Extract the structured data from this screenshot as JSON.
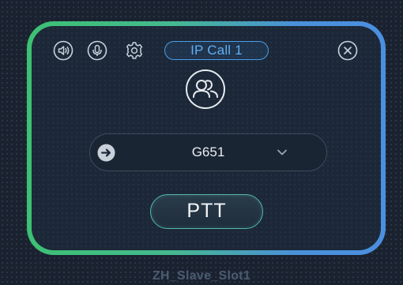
{
  "colors": {
    "frame_left": "#3cc173",
    "frame_right": "#4b8fe0",
    "pill_accent": "#5fb0f5",
    "ptt_border": "#53b8a8",
    "card_bg": "#1c2838"
  },
  "toolbar": {
    "speaker_icon": "speaker-icon",
    "mic_icon": "microphone-icon",
    "settings_icon": "gear-icon",
    "close_icon": "close-icon"
  },
  "call": {
    "title": "IP Call 1",
    "avatar_icon": "group-users-icon"
  },
  "selector": {
    "icon": "arrow-right-circle-icon",
    "value": "G651",
    "chevron_icon": "chevron-down-icon"
  },
  "ptt": {
    "label": "PTT"
  },
  "footer": {
    "label": "ZH_Slave_Slot1"
  }
}
